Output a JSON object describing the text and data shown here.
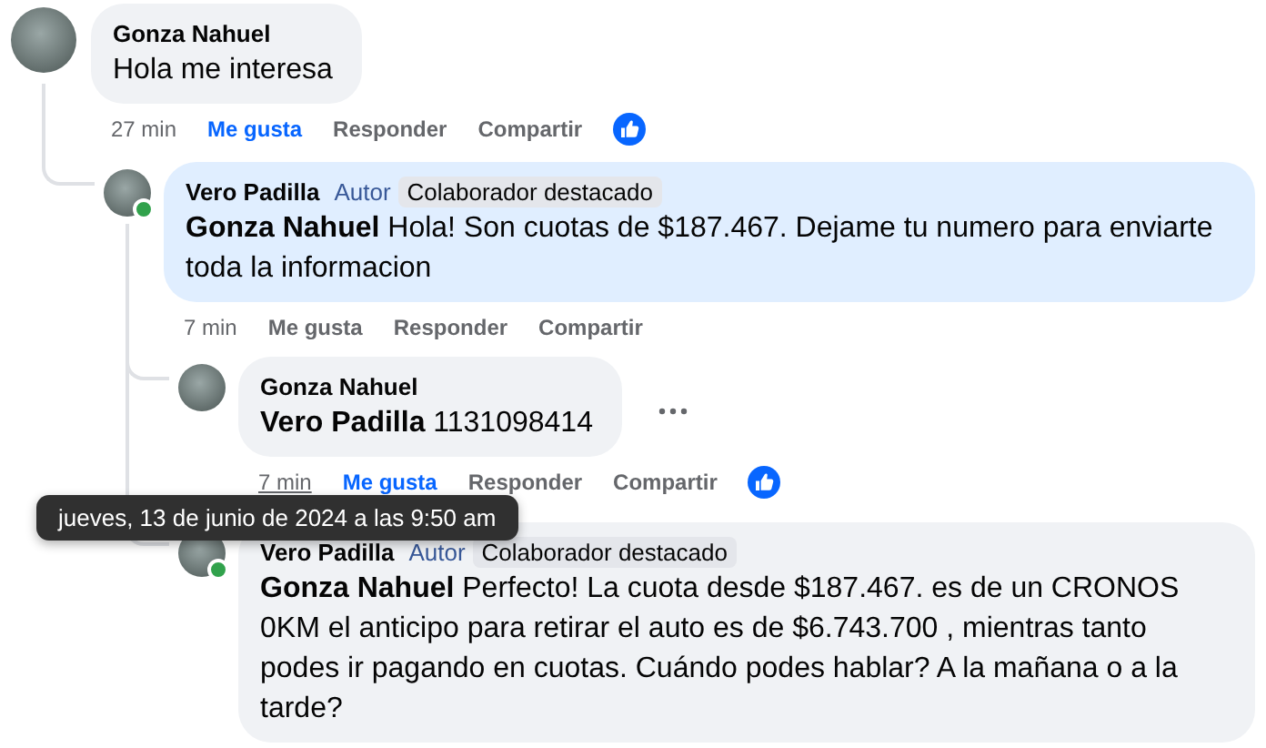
{
  "comments": [
    {
      "author": "Gonza Nahuel",
      "online": false,
      "highlighted": false,
      "text": "Hola me interesa",
      "actions": {
        "time": "27 min",
        "like": "Me gusta",
        "reply": "Responder",
        "share": "Compartir"
      },
      "liked": true,
      "reactions": true,
      "hovered": false,
      "children": [
        {
          "author": "Vero Padilla",
          "online": true,
          "highlighted": true,
          "badges": [
            {
              "label": "Autor",
              "kind": "author"
            },
            {
              "label": "Colaborador destacado",
              "kind": "contributor"
            }
          ],
          "mention": "Gonza Nahuel",
          "text": "Hola! Son cuotas de $187.467. Dejame tu numero para enviarte toda la informacion",
          "actions": {
            "time": "7 min",
            "like": "Me gusta",
            "reply": "Responder",
            "share": "Compartir"
          },
          "liked": false,
          "reactions": false,
          "hovered": false,
          "children": [
            {
              "author": "Gonza Nahuel",
              "online": false,
              "highlighted": false,
              "mention": "Vero Padilla",
              "text": "1131098414",
              "actions": {
                "time": "7 min",
                "like": "Me gusta",
                "reply": "Responder",
                "share": "Compartir"
              },
              "liked": true,
              "reactions": true,
              "hovered": true
            },
            {
              "author": "Vero Padilla",
              "online": true,
              "highlighted": false,
              "badges": [
                {
                  "label": "Autor",
                  "kind": "author"
                },
                {
                  "label": "Colaborador destacado",
                  "kind": "contributor"
                }
              ],
              "mention": "Gonza Nahuel",
              "text": "Perfecto! La cuota desde $187.467. es de un CRONOS 0KM el anticipo para retirar el auto es de $6.743.700 , mientras tanto podes ir pagando en cuotas. Cuándo podes hablar? A la mañana o a la tarde?",
              "hovered": false
            }
          ]
        }
      ]
    }
  ],
  "tooltip": {
    "text": "jueves, 13 de junio de 2024 a las 9:50 am"
  }
}
